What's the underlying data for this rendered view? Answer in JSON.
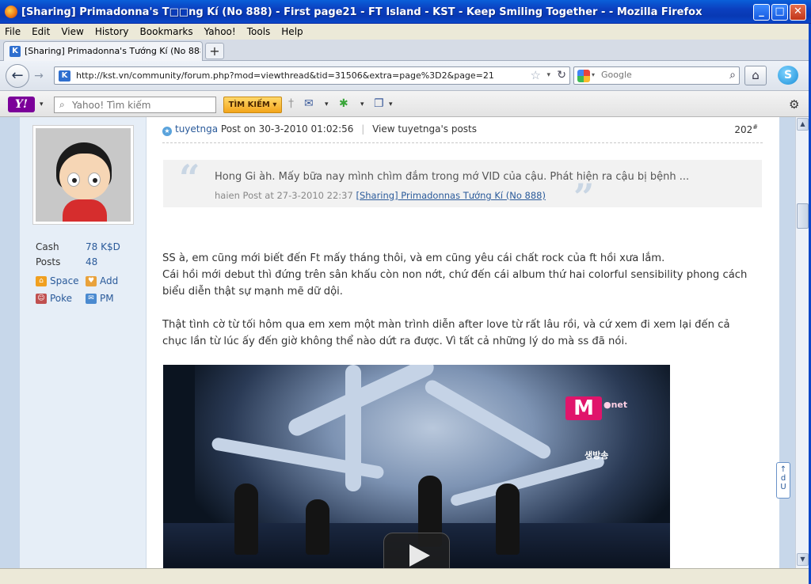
{
  "window": {
    "title": "[Sharing] Primadonna's T□□ng Kí (No 888) - First page21 - FT Island - KST - Keep Smiling Together - - Mozilla Firefox",
    "buttons": {
      "minimize": "_",
      "maximize": "□",
      "close": "✕"
    }
  },
  "menu": [
    "File",
    "Edit",
    "View",
    "History",
    "Bookmarks",
    "Yahoo!",
    "Tools",
    "Help"
  ],
  "tabs": [
    {
      "label": "[Sharing] Primadonna's Tướng Kí (No 888) - ..."
    }
  ],
  "new_tab_label": "+",
  "nav": {
    "url": "http://kst.vn/community/forum.php?mod=viewthread&tid=31506&extra=page%3D2&page=21",
    "search_placeholder": "Google"
  },
  "yahoo_toolbar": {
    "logo": "Y!",
    "search_placeholder": "Yahoo! Tìm kiếm",
    "search_button": "TÌM KIẾM ▾"
  },
  "sidebar": {
    "stats": [
      {
        "label": "Cash",
        "value": "78 K$D"
      },
      {
        "label": "Posts",
        "value": "48"
      }
    ],
    "links": [
      {
        "label": "Space",
        "icon": "house-icon",
        "color": "#f0a020"
      },
      {
        "label": "Add",
        "icon": "handshake-icon",
        "color": "#e9a23b"
      },
      {
        "label": "Poke",
        "icon": "person-icon",
        "color": "#c05050"
      },
      {
        "label": "PM",
        "icon": "envelope-icon",
        "color": "#4a8ad0"
      }
    ]
  },
  "post": {
    "author": "tuyetnga",
    "posted": "Post on 30-3-2010 01:02:56",
    "view_posts": "View tuyetnga's posts",
    "floor": "202",
    "floor_sup": "#",
    "quote": {
      "text": "Hong Gi àh. Mấy bữa nay mình chìm đắm trong mớ VID của cậu. Phát hiện ra cậu bị bệnh  ...",
      "meta": "haien Post at 27-3-2010 22:37",
      "link": "[Sharing] Primadonnas Tướng Kí (No 888)"
    },
    "paragraphs": [
      "SS à, em cũng mới biết đến Ft mấy tháng thôi, và em cũng yêu cái chất rock của ft hồi xưa lắm.\nCái hồi mới debut thì đứng trên sân khấu còn non nớt, chứ đến cái album thứ hai colorful sensibility phong cách biểu diễn thật sự mạnh mẽ dữ dội.",
      "Thật tình cờ từ tối hôm qua em xem một màn trình diễn after love từ rất lâu rồi, và cứ xem đi xem lại đến cả chục lần từ lúc ấy đến giờ không thể nào dứt ra được. Vì tất cả những lý do mà ss đã nói."
    ],
    "video": {
      "logo": "M",
      "logo_tag": "●net",
      "live_tag": "생방송"
    }
  },
  "feedback_label": "↑\nd\nU"
}
